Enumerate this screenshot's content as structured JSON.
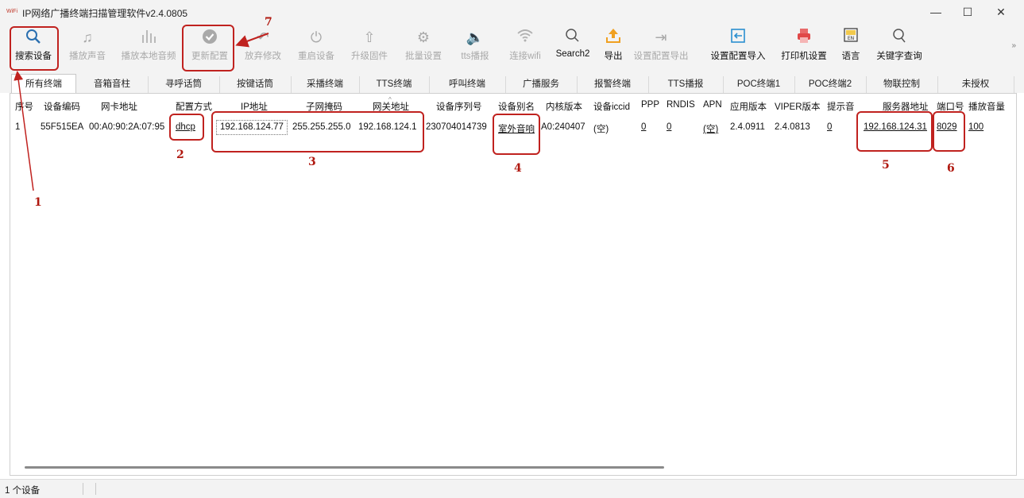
{
  "window": {
    "title": "IP网络广播终端扫描管理软件v2.4.0805",
    "app_icon_label": "WiFi",
    "minimize_label": "—",
    "maximize_label": "☐",
    "close_label": "✕"
  },
  "toolbar": {
    "items": [
      {
        "label": "搜索设备",
        "icon": "search-icon",
        "enabled": true
      },
      {
        "label": "播放声音",
        "icon": "music-note-icon",
        "enabled": false
      },
      {
        "label": "播放本地音频",
        "icon": "audio-bars-icon",
        "enabled": false
      },
      {
        "label": "更新配置",
        "icon": "check-circle-icon",
        "enabled": false
      },
      {
        "label": "放弃修改",
        "icon": "undo-icon",
        "enabled": false
      },
      {
        "label": "重启设备",
        "icon": "power-icon",
        "enabled": false
      },
      {
        "label": "升级固件",
        "icon": "upload-arrow-icon",
        "enabled": false
      },
      {
        "label": "批量设置",
        "icon": "gear-icon",
        "enabled": false
      },
      {
        "label": "tts播报",
        "icon": "speaker-icon",
        "enabled": false
      },
      {
        "label": "连接wifi",
        "icon": "wifi-icon",
        "enabled": false
      },
      {
        "label": "Search2",
        "icon": "search2-icon",
        "enabled": true
      },
      {
        "label": "导出",
        "icon": "export-icon",
        "enabled": true
      },
      {
        "label": "设置配置导出",
        "icon": "config-export-icon",
        "enabled": false
      },
      {
        "label": "设置配置导入",
        "icon": "config-import-icon",
        "enabled": true
      },
      {
        "label": "打印机设置",
        "icon": "printer-icon",
        "enabled": true
      },
      {
        "label": "语言",
        "icon": "language-icon",
        "enabled": true
      },
      {
        "label": "关键字查询",
        "icon": "keyword-search-icon",
        "enabled": true
      }
    ],
    "more_label": "»"
  },
  "tabs": [
    "所有终端",
    "音箱音柱",
    "寻呼话筒",
    "按键话筒",
    "采播终端",
    "TTS终端",
    "呼叫终端",
    "广播服务",
    "报警终端",
    "TTS播报",
    "POC终端1",
    "POC终端2",
    "物联控制",
    "未授权"
  ],
  "table": {
    "columns": [
      "序号",
      "设备编码",
      "网卡地址",
      "配置方式",
      "IP地址",
      "子网掩码",
      "网关地址",
      "设备序列号",
      "设备别名",
      "内核版本",
      "设备iccid",
      "PPP",
      "RNDIS",
      "APN",
      "应用版本",
      "VIPER版本",
      "提示音",
      "服务器地址",
      "端口号",
      "播放音量"
    ],
    "rows": [
      [
        "1",
        "55F515EA",
        "00:A0:90:2A:07:95",
        "dhcp",
        "192.168.124.77",
        "255.255.255.0",
        "192.168.124.1",
        "230704014739",
        "室外音响",
        "A0:240407",
        "(空)",
        "0",
        "0",
        "(空)",
        "2.4.0911",
        "2.4.0813",
        "0",
        "192.168.124.31",
        "8029",
        "100"
      ]
    ]
  },
  "status": {
    "text": "1 个设备"
  },
  "annotations": [
    "1",
    "2",
    "3",
    "4",
    "5",
    "6",
    "7"
  ],
  "colors": {
    "highlight": "#c0221f",
    "window_bg": "#f3f3f3",
    "disabled_text": "#a9a9a9"
  }
}
